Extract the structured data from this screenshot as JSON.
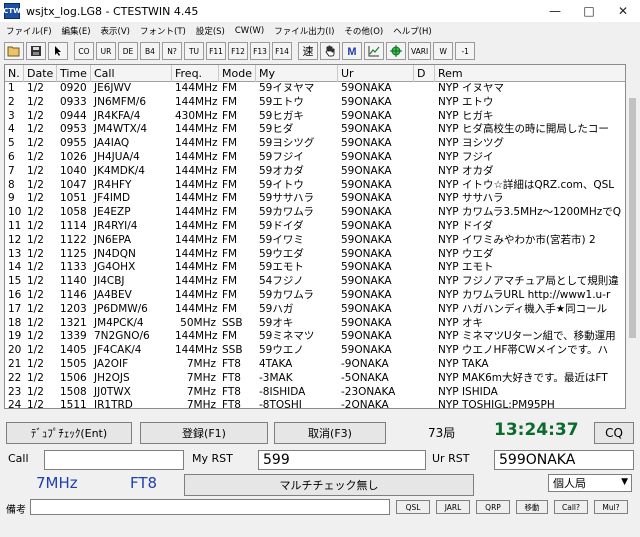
{
  "window": {
    "title": "wsjtx_log.LG8   -  CTESTWIN  4.45",
    "app_icon_text": "CTW",
    "btn_min": "—",
    "btn_max": "□",
    "btn_close": "✕"
  },
  "menu": [
    "ファイル(F)",
    "編集(E)",
    "表示(V)",
    "フォント(T)",
    "設定(S)",
    "CW(W)",
    "ファイル出力(I)",
    "その他(O)",
    "ヘルプ(H)"
  ],
  "toolbar": {
    "open_icon": "folder-open-icon",
    "save_icon": "floppy-icon",
    "co": "CO",
    "ur": "UR",
    "de": "DE",
    "b4": "B4",
    "nr": "N?",
    "tu": "TU",
    "f11": "F11",
    "f12": "F12",
    "f13": "F13",
    "f14": "F14",
    "speed": "速",
    "vari": "VARI",
    "w": "W",
    "minus1": "-1"
  },
  "columns": [
    "N.",
    "Date",
    "Time",
    "Call",
    "Freq.",
    "Mode",
    "My",
    "Ur",
    "D",
    "Rem"
  ],
  "log": [
    [
      "1",
      "1/2",
      "0920",
      "JE6JWV",
      "144MHz",
      "FM",
      "59イヌヤマ",
      "59ONAKA",
      "NYP イヌヤマ"
    ],
    [
      "2",
      "1/2",
      "0933",
      "JN6MFM/6",
      "144MHz",
      "FM",
      "59エトウ",
      "59ONAKA",
      "NYP エトウ"
    ],
    [
      "3",
      "1/2",
      "0944",
      "JR4KFA/4",
      "430MHz",
      "FM",
      "59ヒガキ",
      "59ONAKA",
      "NYP ヒガキ"
    ],
    [
      "4",
      "1/2",
      "0953",
      "JM4WTX/4",
      "144MHz",
      "FM",
      "59ヒダ",
      "59ONAKA",
      "NYP ヒダ高校生の時に開局したコー"
    ],
    [
      "5",
      "1/2",
      "0955",
      "JA4IAQ",
      "144MHz",
      "FM",
      "59ヨシツグ",
      "59ONAKA",
      "NYP ヨシツグ"
    ],
    [
      "6",
      "1/2",
      "1026",
      "JH4JUA/4",
      "144MHz",
      "FM",
      "59フジイ",
      "59ONAKA",
      "NYP フジイ"
    ],
    [
      "7",
      "1/2",
      "1040",
      "JK4MDK/4",
      "144MHz",
      "FM",
      "59オカダ",
      "59ONAKA",
      "NYP オカダ"
    ],
    [
      "8",
      "1/2",
      "1047",
      "JR4HFY",
      "144MHz",
      "FM",
      "59イトウ",
      "59ONAKA",
      "NYP イトウ☆詳細はQRZ.com、QSL"
    ],
    [
      "9",
      "1/2",
      "1051",
      "JF4IMD",
      "144MHz",
      "FM",
      "59ササハラ",
      "59ONAKA",
      "NYP ササハラ"
    ],
    [
      "10",
      "1/2",
      "1058",
      "JE4EZP",
      "144MHz",
      "FM",
      "59カワムラ",
      "59ONAKA",
      "NYP カワムラ3.5MHz〜1200MHzでQ"
    ],
    [
      "11",
      "1/2",
      "1114",
      "JR4RYI/4",
      "144MHz",
      "FM",
      "59ドイダ",
      "59ONAKA",
      "NYP ドイダ"
    ],
    [
      "12",
      "1/2",
      "1122",
      "JN6EPA",
      "144MHz",
      "FM",
      "59イワミ",
      "59ONAKA",
      "NYP イワミみやわか市(宮若市)  2"
    ],
    [
      "13",
      "1/2",
      "1125",
      "JN4DQN",
      "144MHz",
      "FM",
      "59ウエダ",
      "59ONAKA",
      "NYP ウエダ"
    ],
    [
      "14",
      "1/2",
      "1133",
      "JG4OHX",
      "144MHz",
      "FM",
      "59エモト",
      "59ONAKA",
      "NYP エモト"
    ],
    [
      "15",
      "1/2",
      "1140",
      "JI4CBJ",
      "144MHz",
      "FM",
      "54フジノ",
      "59ONAKA",
      "NYP フジノアマチュア局として規則違"
    ],
    [
      "16",
      "1/2",
      "1146",
      "JA4BEV",
      "144MHz",
      "FM",
      "59カワムラ",
      "59ONAKA",
      "NYP カワムラURL http://www1.u-r"
    ],
    [
      "17",
      "1/2",
      "1203",
      "JP6DMW/6",
      "144MHz",
      "FM",
      "59ハガ",
      "59ONAKA",
      "NYP ハガハンディ機入手★同コール"
    ],
    [
      "18",
      "1/2",
      "1321",
      "JM4PCK/4",
      "50MHz",
      "SSB",
      "59オキ",
      "59ONAKA",
      "NYP オキ"
    ],
    [
      "19",
      "1/2",
      "1339",
      "7N2GNO/6",
      "144MHz",
      "FM",
      "59ミネマツ",
      "59ONAKA",
      "NYP ミネマツUターン組で、移動運用"
    ],
    [
      "20",
      "1/2",
      "1405",
      "JF4CAK/4",
      "144MHz",
      "SSB",
      "59ウエノ",
      "59ONAKA",
      "NYP ウエノHF帯CWメインです。ハ"
    ],
    [
      "21",
      "1/2",
      "1505",
      "JA2OIF",
      "7MHz",
      "FT8",
      "4TAKA",
      "-9ONAKA",
      "NYP TAKA"
    ],
    [
      "22",
      "1/2",
      "1506",
      "JH2OJS",
      "7MHz",
      "FT8",
      "-3MAK",
      "-5ONAKA",
      "NYP MAK6m大好きです。最近はFT"
    ],
    [
      "23",
      "1/2",
      "1508",
      "JJ0TWX",
      "7MHz",
      "FT8",
      "-8ISHIDA",
      "-23ONAKA",
      "NYP ISHIDA"
    ],
    [
      "24",
      "1/2",
      "1511",
      "JR1TRD",
      "7MHz",
      "FT8",
      "-8TOSHI",
      "-2ONAKA",
      "NYP TOSHIGL:PM95PH"
    ]
  ],
  "entry": {
    "dupe_check": "ﾃﾞｭﾌﾟﾁｪｯｸ(Ent)",
    "register": "登録(F1)",
    "cancel": "取消(F3)",
    "station_count": "73局",
    "clock": "13:24:37",
    "cq": "CQ",
    "call_label": "Call",
    "call_value": "",
    "my_rst_label": "My RST",
    "my_rst_value": "599",
    "ur_rst_label": "Ur RST",
    "ur_rst_value": "599ONAKA",
    "band": "7MHz",
    "mode": "FT8",
    "multi_check": "マルチチェック無し",
    "station_type": "個人局",
    "remarks_label": "備考",
    "remarks_value": "",
    "qsl": "QSL",
    "jarl": "JARL",
    "qrp": "QRP",
    "move": "移動",
    "call_q": "Call?",
    "mul_q": "Mul?"
  },
  "colors": {
    "clock": "#0a6b2c",
    "band": "#1f3fb3",
    "accent": "#1a4fa3"
  }
}
